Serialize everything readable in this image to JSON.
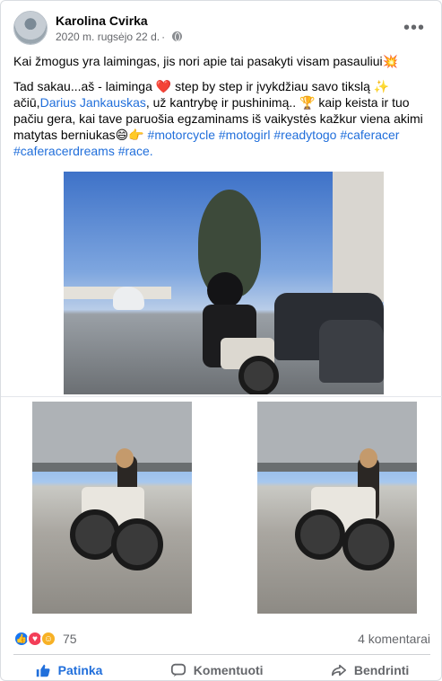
{
  "post": {
    "author": "Karolina Cvirka",
    "date": "2020 m. rugsėjo 22 d.",
    "date_separator": "·",
    "more_icon": "more-horizontal-icon",
    "privacy_icon": "globe-icon",
    "text_line1": "Kai žmogus yra laimingas, jis nori apie tai pasakyti visam pasauliui💥",
    "text_p2_a": "Tad sakau...aš - laiminga ❤️ step by step ir įvykdžiau savo tikslą ✨ ačiū,",
    "mention": "Darius Jankauskas",
    "text_p2_b": ", už kantrybę ir pushinimą.. 🏆 kaip keista ir tuo pačiu gera, kai tave paruošia egzaminams iš vaikystės kažkur viena akimi matytas berniukas😄👉 ",
    "hashtags": [
      "#motorcycle",
      "#motogirl",
      "#readytogo",
      "#caferacer",
      "#caferacerdreams",
      "#race."
    ]
  },
  "photos": [
    {
      "description_label": ""
    },
    {
      "description_label": ""
    },
    {
      "description_label": ""
    }
  ],
  "stats": {
    "reaction_count": "75",
    "comments": "4 komentarai",
    "reaction_types": [
      "like",
      "love",
      "care"
    ]
  },
  "actions": {
    "like": "Patinka",
    "comment": "Komentuoti",
    "share": "Bendrinti"
  },
  "colors": {
    "link": "#216fdb",
    "secondary_text": "#65676b",
    "like_blue": "#1877f2",
    "love_red": "#f33e58"
  }
}
